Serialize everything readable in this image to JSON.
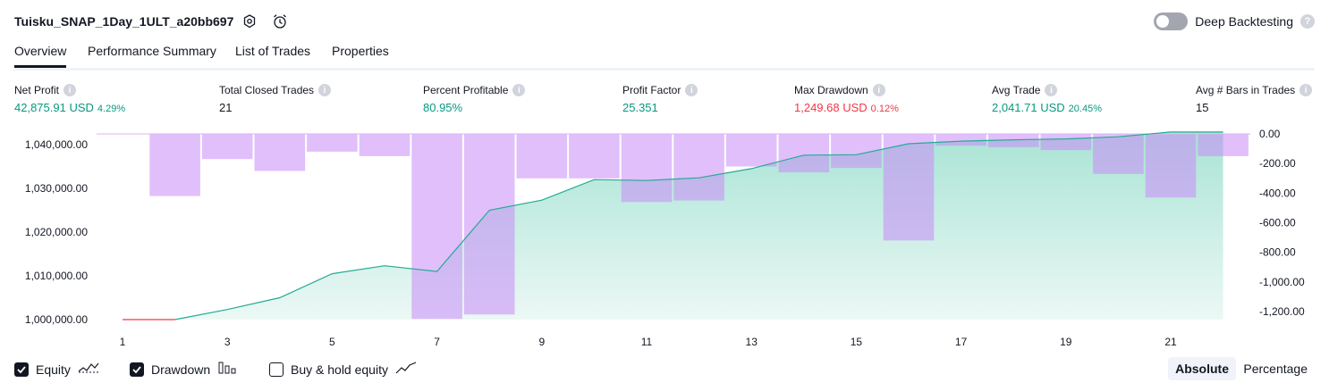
{
  "header": {
    "strategy_name": "Tuisku_SNAP_1Day_1ULT_a20bb697",
    "deep_backtesting_label": "Deep Backtesting",
    "deep_backtesting_on": false
  },
  "tabs": [
    {
      "label": "Overview",
      "active": true
    },
    {
      "label": "Performance Summary",
      "active": false
    },
    {
      "label": "List of Trades",
      "active": false
    },
    {
      "label": "Properties",
      "active": false
    }
  ],
  "metrics": [
    {
      "label": "Net Profit",
      "value": "42,875.91 USD",
      "pct": "4.29%",
      "tone": "green"
    },
    {
      "label": "Total Closed Trades",
      "value": "21",
      "pct": "",
      "tone": "plain"
    },
    {
      "label": "Percent Profitable",
      "value": "80.95%",
      "pct": "",
      "tone": "green"
    },
    {
      "label": "Profit Factor",
      "value": "25.351",
      "pct": "",
      "tone": "green"
    },
    {
      "label": "Max Drawdown",
      "value": "1,249.68 USD",
      "pct": "0.12%",
      "tone": "red"
    },
    {
      "label": "Avg Trade",
      "value": "2,041.71 USD",
      "pct": "20.45%",
      "tone": "green"
    },
    {
      "label": "Avg # Bars in Trades",
      "value": "15",
      "pct": "",
      "tone": "plain"
    }
  ],
  "chart_data": {
    "type": "line",
    "x_ticks": [
      "1",
      "3",
      "5",
      "7",
      "9",
      "11",
      "13",
      "15",
      "17",
      "19",
      "21"
    ],
    "left_axis": {
      "ticks": [
        "1,040,000.00",
        "1,030,000.00",
        "1,020,000.00",
        "1,010,000.00",
        "1,000,000.00"
      ],
      "tick_values": [
        1040000,
        1030000,
        1020000,
        1010000,
        1000000
      ]
    },
    "right_axis": {
      "ticks": [
        "0.00",
        "-200.00",
        "-400.00",
        "-600.00",
        "-800.00",
        "-1,000.00",
        "-1,200.00"
      ],
      "tick_values": [
        0,
        -200,
        -400,
        -600,
        -800,
        -1000,
        -1200
      ]
    },
    "series": [
      {
        "name": "Equity",
        "kind": "line",
        "x": [
          1,
          2,
          3,
          4,
          5,
          6,
          7,
          8,
          9,
          10,
          11,
          12,
          13,
          14,
          15,
          16,
          17,
          18,
          19,
          20,
          21,
          22
        ],
        "values": [
          1000000,
          1000000,
          1002300,
          1005000,
          1010500,
          1012300,
          1011000,
          1025000,
          1027300,
          1032000,
          1031800,
          1032400,
          1034500,
          1037600,
          1037700,
          1040200,
          1040800,
          1041100,
          1041300,
          1041800,
          1042875,
          1042875
        ],
        "color": "#22ab94"
      },
      {
        "name": "Drawdown",
        "kind": "bar",
        "x": [
          1,
          2,
          3,
          4,
          5,
          6,
          7,
          8,
          9,
          10,
          11,
          12,
          13,
          14,
          15,
          16,
          17,
          18,
          19,
          20,
          21,
          22
        ],
        "values": [
          0,
          -420,
          -170,
          -250,
          -120,
          -150,
          -1249.68,
          -1220,
          -300,
          -300,
          -460,
          -450,
          -220,
          -260,
          -230,
          -720,
          -80,
          -90,
          -110,
          -270,
          -430,
          -150
        ],
        "color": "#c98af7"
      }
    ]
  },
  "legend": {
    "items": [
      {
        "label": "Equity",
        "checked": true,
        "icon": "equity-line-icon"
      },
      {
        "label": "Drawdown",
        "checked": true,
        "icon": "drawdown-bars-icon"
      },
      {
        "label": "Buy & hold equity",
        "checked": false,
        "icon": "buy-hold-line-icon"
      }
    ],
    "modes": [
      {
        "label": "Absolute",
        "active": true
      },
      {
        "label": "Percentage",
        "active": false
      }
    ]
  }
}
